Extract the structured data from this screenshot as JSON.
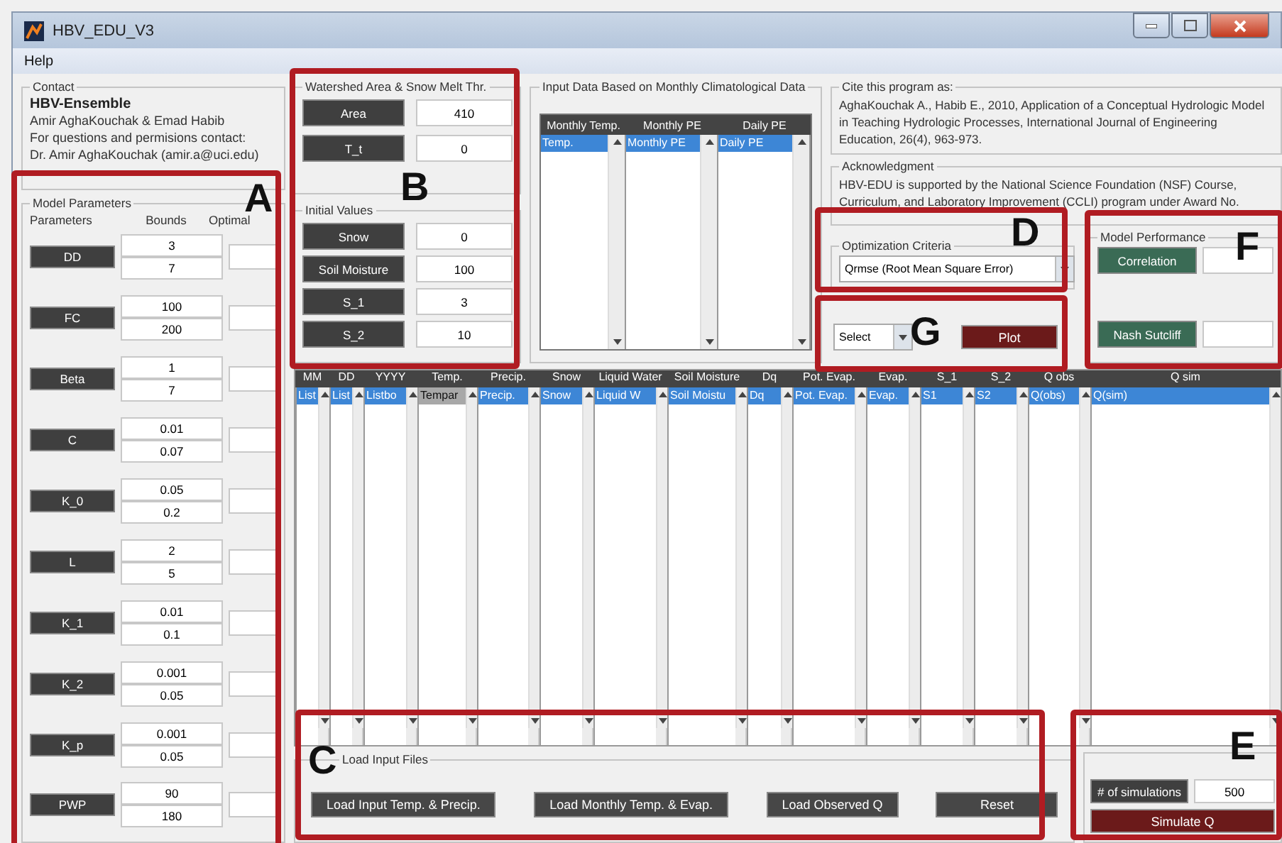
{
  "window": {
    "title": "HBV_EDU_V3"
  },
  "menu": [
    "Help"
  ],
  "contact": {
    "legend": "Contact",
    "name": "HBV-Ensemble",
    "lines": [
      "Amir AghaKouchak  &  Emad Habib",
      "For questions and permisions contact:",
      "Dr. Amir AghaKouchak (amir.a@uci.edu)"
    ]
  },
  "model_parameters": {
    "legend": "Model Parameters",
    "col_parameters": "Parameters",
    "col_bounds": "Bounds",
    "col_optimal": "Optimal",
    "rows": [
      {
        "name": "DD",
        "lower": "3",
        "upper": "7"
      },
      {
        "name": "FC",
        "lower": "100",
        "upper": "200"
      },
      {
        "name": "Beta",
        "lower": "1",
        "upper": "7"
      },
      {
        "name": "C",
        "lower": "0.01",
        "upper": "0.07"
      },
      {
        "name": "K_0",
        "lower": "0.05",
        "upper": "0.2"
      },
      {
        "name": "L",
        "lower": "2",
        "upper": "5"
      },
      {
        "name": "K_1",
        "lower": "0.01",
        "upper": "0.1"
      },
      {
        "name": "K_2",
        "lower": "0.001",
        "upper": "0.05"
      },
      {
        "name": "K_p",
        "lower": "0.001",
        "upper": "0.05"
      },
      {
        "name": "PWP",
        "lower": "90",
        "upper": "180"
      }
    ]
  },
  "watershed": {
    "legend": "Watershed Area & Snow Melt Thr.",
    "fields": [
      {
        "label": "Area",
        "value": "410"
      },
      {
        "label": "T_t",
        "value": "0"
      }
    ]
  },
  "initial_values": {
    "legend": "Initial Values",
    "fields": [
      {
        "label": "Snow",
        "value": "0"
      },
      {
        "label": "Soil Moisture",
        "value": "100"
      },
      {
        "label": "S_1",
        "value": "3"
      },
      {
        "label": "S_2",
        "value": "10"
      }
    ]
  },
  "input_data": {
    "legend": "Input Data Based on Monthly Climatological Data",
    "columns": [
      {
        "header": "Monthly Temp.",
        "item": "Temp."
      },
      {
        "header": "Monthly PE",
        "item": "Monthly PE"
      },
      {
        "header": "Daily PE",
        "item": "Daily PE"
      }
    ]
  },
  "cite": {
    "legend": "Cite this program as:",
    "text": "AghaKouchak A., Habib E., 2010,  Application of a Conceptual Hydrologic Model in Teaching Hydrologic Processes, International Journal of Engineering Education, 26(4), 963-973."
  },
  "acknowledgment": {
    "legend": "Acknowledgment",
    "text": "HBV-EDU is supported by the National Science Foundation (NSF) Course, Curriculum, and Laboratory Improvement (CCLI) program under Award No."
  },
  "optimization": {
    "legend": "Optimization Criteria",
    "value": "Qrmse  (Root Mean Square Error)"
  },
  "plot": {
    "select": "Select",
    "button": "Plot"
  },
  "model_performance": {
    "legend": "Model Performance",
    "metrics": [
      "Correlation",
      "Nash Sutcliff"
    ]
  },
  "table": {
    "columns": [
      {
        "header": "MM",
        "item": "List",
        "focused": true
      },
      {
        "header": "DD",
        "item": "List",
        "focused": true
      },
      {
        "header": "YYYY",
        "item": "Listbo",
        "focused": true
      },
      {
        "header": "Temp.",
        "item": "Tempar",
        "focused": false
      },
      {
        "header": "Precip.",
        "item": "Precip.",
        "focused": true
      },
      {
        "header": "Snow",
        "item": "Snow",
        "focused": true
      },
      {
        "header": "Liquid Water",
        "item": "Liquid W",
        "focused": true
      },
      {
        "header": "Soil Moisture",
        "item": "Soil Moistu",
        "focused": true
      },
      {
        "header": "Dq",
        "item": "Dq",
        "focused": true
      },
      {
        "header": "Pot. Evap.",
        "item": "Pot. Evap.",
        "focused": true
      },
      {
        "header": "Evap.",
        "item": "Evap.",
        "focused": true
      },
      {
        "header": "S_1",
        "item": "S1",
        "focused": true
      },
      {
        "header": "S_2",
        "item": "S2",
        "focused": true
      },
      {
        "header": "Q obs",
        "item": "Q(obs)",
        "focused": true
      },
      {
        "header": "Q sim",
        "item": "Q(sim)",
        "focused": true
      }
    ]
  },
  "load_files": {
    "legend": "Load Input Files",
    "buttons": [
      "Load Input Temp. & Precip.",
      "Load Monthly Temp. & Evap.",
      "Load Observed Q",
      "Reset"
    ]
  },
  "run": {
    "label": "# of simulations",
    "value": "500",
    "button": "Simulate Q"
  },
  "annotations": [
    "A",
    "B",
    "C",
    "D",
    "E",
    "F",
    "G"
  ]
}
